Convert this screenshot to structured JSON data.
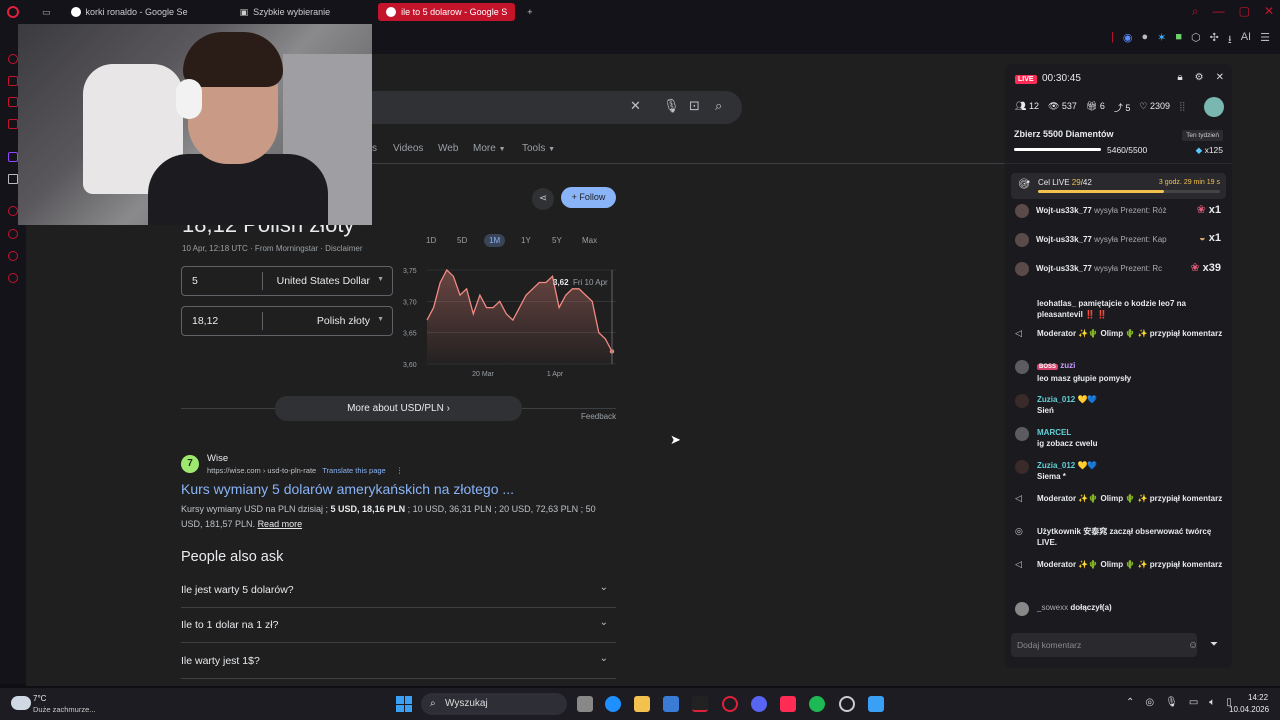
{
  "browser": {
    "tabs": [
      {
        "label": "korki ronaldo - Google Se",
        "active": false
      },
      {
        "label": "Szybkie wybieranie",
        "active": false
      },
      {
        "label": "ile to 5 dolarow - Google S",
        "active": true
      }
    ],
    "new_tab": "+",
    "extensions_ai": "AI"
  },
  "google": {
    "nav": [
      "s",
      "Videos",
      "Web",
      "More",
      "Tools"
    ],
    "result_title": "18,12 Polish złoty",
    "meta": "10 Apr, 12:18 UTC · From Morningstar · Disclaimer",
    "follow_label": "Follow",
    "converter": {
      "from_amount": "5",
      "from_currency": "United States Dollar",
      "to_amount": "18,12",
      "to_currency": "Polish złoty"
    },
    "ranges": [
      "1D",
      "5D",
      "1M",
      "1Y",
      "5Y",
      "Max"
    ],
    "active_range": "1M",
    "more_about": "More about USD/PLN",
    "feedback": "Feedback",
    "wise": {
      "name": "Wise",
      "url": "https://wise.com › usd-to-pln-rate",
      "translate": "Translate this page",
      "title": "Kurs wymiany 5 dolarów amerykańskich na złotego ...",
      "snippet_pre": "Kursy wymiany USD na PLN dzisiaj ; ",
      "snippet_bold": "5 USD, 18,16 PLN",
      "snippet_post": " ; 10 USD, 36,31 PLN ; 20 USD, 72,63 PLN ; 50 USD, 181,57 PLN.",
      "read_more": "Read more"
    },
    "paa_title": "People also ask",
    "paa": [
      "Ile jest warty 5 dolarów?",
      "Ile to 1 dolar na 1 zł?",
      "Ile warty jest 1$?"
    ]
  },
  "chart_data": {
    "type": "line",
    "title": "",
    "xlabel": "",
    "ylabel": "",
    "ylim": [
      3.6,
      3.75
    ],
    "yticks": [
      "3,75",
      "3,70",
      "3,65",
      "3,60"
    ],
    "xticks": [
      "20 Mar",
      "1 Apr"
    ],
    "values": [
      3.67,
      3.69,
      3.73,
      3.75,
      3.74,
      3.71,
      3.72,
      3.68,
      3.71,
      3.69,
      3.69,
      3.7,
      3.68,
      3.67,
      3.69,
      3.71,
      3.72,
      3.73,
      3.73,
      3.74,
      3.69,
      3.71,
      3.72,
      3.72,
      3.71,
      3.7,
      3.65,
      3.64,
      3.62
    ],
    "tooltip_value": "3,62",
    "tooltip_date": "Fri 10 Apr",
    "color": "#f28b82"
  },
  "live": {
    "badge": "LIVE",
    "timer": "00:30:45",
    "stats": [
      "12",
      "537",
      "6",
      "5",
      "2309"
    ],
    "goal_title": "Zbierz 5500 Diamentów",
    "goal_badge": "Ten tydzień",
    "goal_count": "5460/5500",
    "goal_mult": "x125",
    "goal_progress": 0.99,
    "cel_label_pre": "Cel LIVE ",
    "cel_current": "29",
    "cel_total": "/42",
    "cel_time": "3 godz. 29 min 19 s",
    "cel_progress": 0.69,
    "gifts": [
      {
        "user": "Wojt-us33k_77",
        "action": "wysyła Prezent: Róż",
        "count": "x1"
      },
      {
        "user": "Wojt-us33k_77",
        "action": "wysyła Prezent: Kap",
        "count": "x1"
      },
      {
        "user": "Wojt-us33k_77",
        "action": "wysyła Prezent: Rc",
        "count": "x39"
      }
    ],
    "chat": [
      {
        "name": "",
        "msg": "leohatlas_ pamiętajcie o kodzie leo7 na pleasantevil ‼️ ‼️"
      },
      {
        "name": "Moderator ✨🌵 Olimp 🌵 ✨",
        "msg": "przypiął komentarz"
      },
      {
        "name": "zuzi",
        "badge": "BOSS",
        "msg": "leo masz głupie pomysły"
      },
      {
        "name": "Zuzia_012 💛💙",
        "msg": "Sień"
      },
      {
        "name": "MARCEL",
        "msg": "ig zobacz cwelu"
      },
      {
        "name": "Zuzia_012 💛💙",
        "msg": "Siema *"
      },
      {
        "name": "Moderator ✨🌵 Olimp 🌵 ✨",
        "msg": "przypiął komentarz"
      },
      {
        "name": "Użytkownik 安泰窕",
        "msg": "zaczął obserwować twórcę LIVE."
      },
      {
        "name": "Moderator ✨🌵 Olimp 🌵 ✨",
        "msg": "przypiął komentarz"
      },
      {
        "name": "_sowexx",
        "msg": "dołączył(a)"
      }
    ],
    "comment_placeholder": "Dodaj komentarz"
  },
  "taskbar": {
    "temp": "7°C",
    "condition": "Duże zachmurze...",
    "search": "Wyszukaj",
    "time": "14:22",
    "date": "10.04.2026"
  }
}
